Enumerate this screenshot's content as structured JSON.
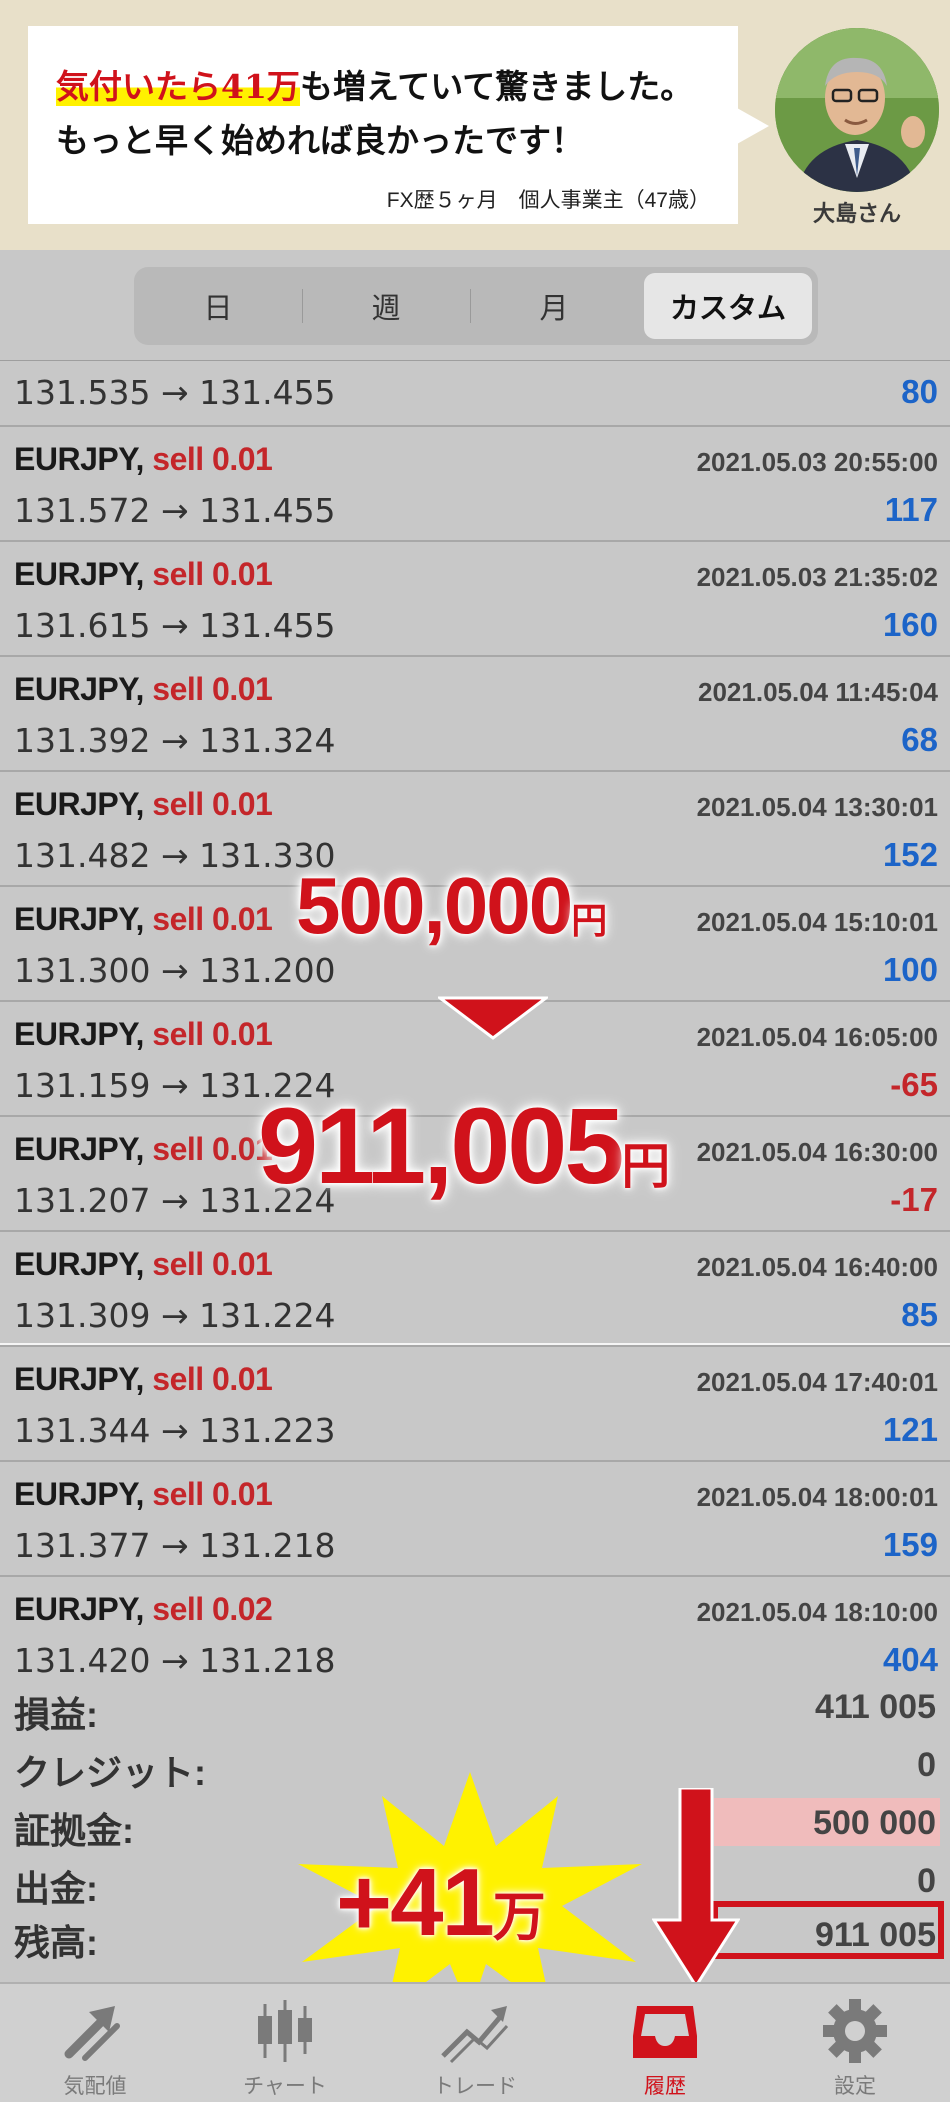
{
  "banner": {
    "quote_highlight": "気付いたら41万",
    "quote_line1_rest": "も増えていて驚きました。",
    "quote_line2": "もっと早く始めれば良かったです！",
    "profile": "FX歴５ヶ月　個人事業主（47歳）",
    "name": "大島さん"
  },
  "period_tabs": [
    {
      "label": "日",
      "active": false
    },
    {
      "label": "週",
      "active": false
    },
    {
      "label": "月",
      "active": false
    },
    {
      "label": "カスタム",
      "active": true
    }
  ],
  "first_row": {
    "prices": "131.535 → 131.455",
    "profit": "80"
  },
  "trades": [
    {
      "symbol": "EURJPY,",
      "side": "sell 0.01",
      "time": "2021.05.03 20:55:00",
      "prices": "131.572 → 131.455",
      "profit": "117"
    },
    {
      "symbol": "EURJPY,",
      "side": "sell 0.01",
      "time": "2021.05.03 21:35:02",
      "prices": "131.615 → 131.455",
      "profit": "160"
    },
    {
      "symbol": "EURJPY,",
      "side": "sell 0.01",
      "time": "2021.05.04 11:45:04",
      "prices": "131.392 → 131.324",
      "profit": "68"
    },
    {
      "symbol": "EURJPY,",
      "side": "sell 0.01",
      "time": "2021.05.04 13:30:01",
      "prices": "131.482 → 131.330",
      "profit": "152"
    },
    {
      "symbol": "EURJPY,",
      "side": "sell 0.01",
      "time": "2021.05.04 15:10:01",
      "prices": "131.300 → 131.200",
      "profit": "100"
    },
    {
      "symbol": "EURJPY,",
      "side": "sell 0.01",
      "time": "2021.05.04 16:05:00",
      "prices": "131.159 → 131.224",
      "profit": "-65"
    },
    {
      "symbol": "EURJPY,",
      "side": "sell 0.01",
      "time": "2021.05.04 16:30:00",
      "prices": "131.207 → 131.224",
      "profit": "-17"
    },
    {
      "symbol": "EURJPY,",
      "side": "sell 0.01",
      "time": "2021.05.04 16:40:00",
      "prices": "131.309 → 131.224",
      "profit": "85"
    },
    {
      "symbol": "EURJPY,",
      "side": "sell 0.01",
      "time": "2021.05.04 17:40:01",
      "prices": "131.344 → 131.223",
      "profit": "121"
    },
    {
      "symbol": "EURJPY,",
      "side": "sell 0.01",
      "time": "2021.05.04 18:00:01",
      "prices": "131.377 → 131.218",
      "profit": "159"
    },
    {
      "symbol": "EURJPY,",
      "side": "sell 0.02",
      "time": "2021.05.04 18:10:00",
      "prices": "131.420 → 131.218",
      "profit": "404"
    }
  ],
  "summary": [
    {
      "label": "損益:",
      "value": "411 005"
    },
    {
      "label": "クレジット:",
      "value": "0"
    },
    {
      "label": "証拠金:",
      "value": "500 000"
    },
    {
      "label": "出金:",
      "value": "0"
    },
    {
      "label": "残高:",
      "value": "911 005"
    }
  ],
  "overlay": {
    "start_amount": "500,000",
    "end_amount": "911,005",
    "yen": "円",
    "gain": "+41",
    "gain_unit": "万"
  },
  "tabbar": [
    {
      "label": "気配値",
      "icon": "quotes-arrows-icon",
      "active": false
    },
    {
      "label": "チャート",
      "icon": "candlestick-chart-icon",
      "active": false
    },
    {
      "label": "トレード",
      "icon": "trade-trend-icon",
      "active": false
    },
    {
      "label": "履歴",
      "icon": "history-inbox-icon",
      "active": true
    },
    {
      "label": "設定",
      "icon": "settings-gear-icon",
      "active": false
    }
  ],
  "colors": {
    "accent_red": "#d0121b",
    "profit_blue": "#1c64c8",
    "loss_red": "#c4262a",
    "highlight_yellow": "#fff100"
  }
}
